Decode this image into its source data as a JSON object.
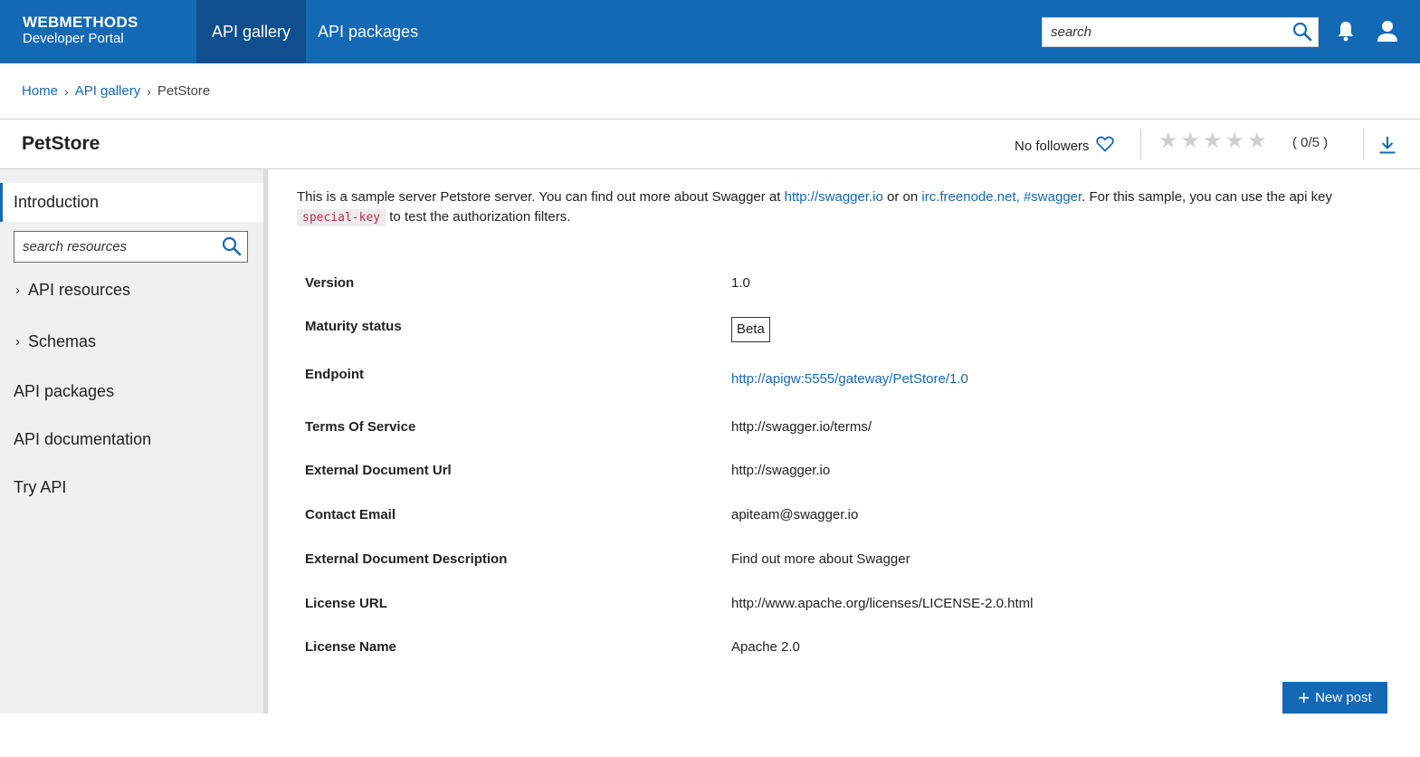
{
  "header": {
    "logo_line1": "WEBMETHODS",
    "logo_line2": "Developer Portal",
    "tabs": [
      {
        "label": "API gallery",
        "active": true
      },
      {
        "label": "API packages",
        "active": false
      }
    ],
    "search_placeholder": "search",
    "icons": [
      "search-icon",
      "bell-icon",
      "user-icon"
    ]
  },
  "breadcrumb": [
    "Home",
    "API gallery",
    "PetStore"
  ],
  "title_row": {
    "title": "PetStore",
    "followers": "No followers",
    "rating_stars": 0,
    "rating_max": 5,
    "rating_text": "( 0/5 )"
  },
  "sidebar": {
    "intro": "Introduction",
    "search_placeholder": "search resources",
    "items": [
      {
        "label": "API resources",
        "expandable": true
      },
      {
        "label": "Schemas",
        "expandable": true
      },
      {
        "label": "API packages",
        "expandable": false
      },
      {
        "label": "API documentation",
        "expandable": false
      },
      {
        "label": "Try API",
        "expandable": false
      }
    ]
  },
  "intro": {
    "text1": "This is a sample server Petstore server. You can find out more about Swagger at ",
    "link1": "http://swagger.io",
    "text2": " or on ",
    "link2": "irc.freenode.net, #swagger",
    "text3": ". For this sample, you can use the api key ",
    "code": "special-key",
    "text4": " to test the authorization filters."
  },
  "details": [
    {
      "label": "Version",
      "value": "1.0"
    },
    {
      "label": "Maturity status",
      "value": "Beta"
    },
    {
      "label": "Endpoint",
      "value": "http://apigw:5555/gateway/PetStore/1.0"
    },
    {
      "label": "Terms Of Service",
      "value": "http://swagger.io/terms/"
    },
    {
      "label": "External Document Url",
      "value": "http://swagger.io"
    },
    {
      "label": "Contact Email",
      "value": "apiteam@swagger.io"
    },
    {
      "label": "External Document Description",
      "value": "Find out more about Swagger"
    },
    {
      "label": "License URL",
      "value": "http://www.apache.org/licenses/LICENSE-2.0.html"
    },
    {
      "label": "License Name",
      "value": "Apache 2.0"
    }
  ],
  "new_post_label": "New post",
  "colors": {
    "brand": "#1469b5",
    "brand_dark": "#0f4f8e",
    "code_text": "#c7254e"
  }
}
